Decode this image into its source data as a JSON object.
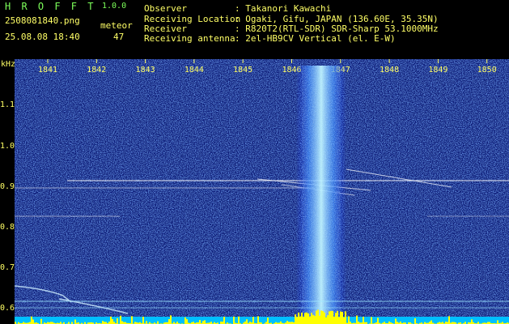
{
  "app": {
    "name": "H R O F F T",
    "version": "1.0.0"
  },
  "file": {
    "name": "2508081840.png",
    "datetime": "25.08.08 18:40"
  },
  "meteor": {
    "label": "meteor",
    "count": "47"
  },
  "station": [
    {
      "label": "Observer",
      "value": ": Takanori Kawachi"
    },
    {
      "label": "Receiving Location",
      "value": ": Ogaki, Gifu, JAPAN (136.60E, 35.35N)"
    },
    {
      "label": "Receiver",
      "value": ": R820T2(RTL-SDR) SDR-Sharp 53.1000MHz"
    },
    {
      "label": "Receiving antenna",
      "value": ": 2el-HB9CV Vertical (el. E-W)"
    }
  ],
  "axis": {
    "y_unit": "kHz",
    "y_ticks": [
      "1.1",
      "1.0",
      "0.9",
      "0.8",
      "0.7",
      "0.6"
    ],
    "x_ticks": [
      "1841",
      "1842",
      "1843",
      "1844",
      "1845",
      "1846",
      "1847",
      "1848",
      "1849",
      "1850"
    ]
  },
  "colors": {
    "background": "#000000",
    "noise_base": "#0d1a7a",
    "noise_bright": "#3f6cff",
    "echo": "#ffffff",
    "band": "#9fe8ff",
    "header_text": "#ffff66",
    "title_text": "#7dff5a",
    "floor": "#ffff00",
    "floor_base": "#00bfff"
  }
}
